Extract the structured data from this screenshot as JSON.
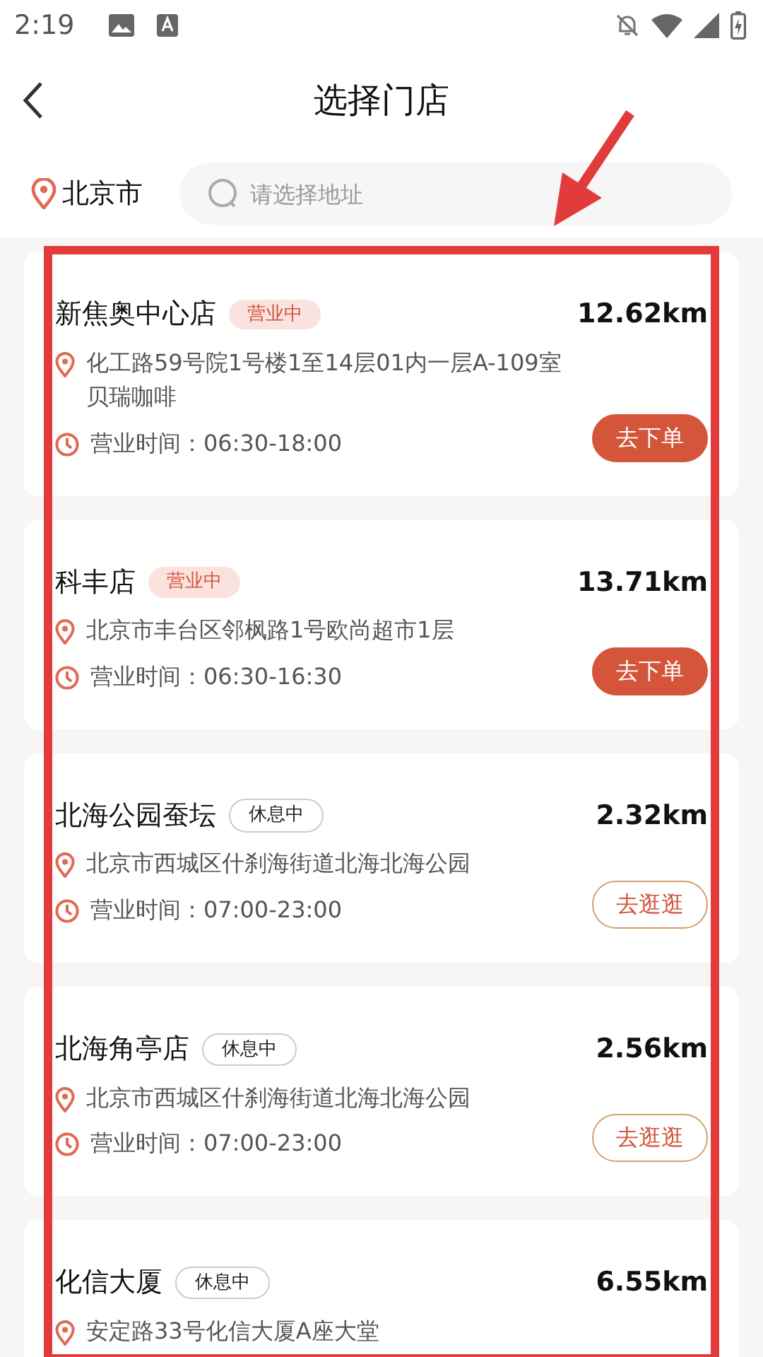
{
  "status_bar": {
    "time": "2:19"
  },
  "header": {
    "title": "选择门店"
  },
  "location": {
    "city": "北京市",
    "search_placeholder": "请选择地址"
  },
  "stores": [
    {
      "name": "新焦奥中心店",
      "open": true,
      "status": "营业中",
      "distance": "12.62km",
      "address": "化工路59号院1号楼1至14层01内一层A-109室贝瑞咖啡",
      "hours": "营业时间：06:30-18:00",
      "action": "去下单"
    },
    {
      "name": "科丰店",
      "open": true,
      "status": "营业中",
      "distance": "13.71km",
      "address": "北京市丰台区邻枫路1号欧尚超市1层",
      "hours": "营业时间：06:30-16:30",
      "action": "去下单"
    },
    {
      "name": "北海公园蚕坛",
      "open": false,
      "status": "休息中",
      "distance": "2.32km",
      "address": "北京市西城区什刹海街道北海北海公园",
      "hours": "营业时间：07:00-23:00",
      "action": "去逛逛"
    },
    {
      "name": "北海角亭店",
      "open": false,
      "status": "休息中",
      "distance": "2.56km",
      "address": "北京市西城区什刹海街道北海北海公园",
      "hours": "营业时间：07:00-23:00",
      "action": "去逛逛"
    },
    {
      "name": "化信大厦",
      "open": false,
      "status": "休息中",
      "distance": "6.55km",
      "address": "安定路33号化信大厦A座大堂"
    }
  ]
}
